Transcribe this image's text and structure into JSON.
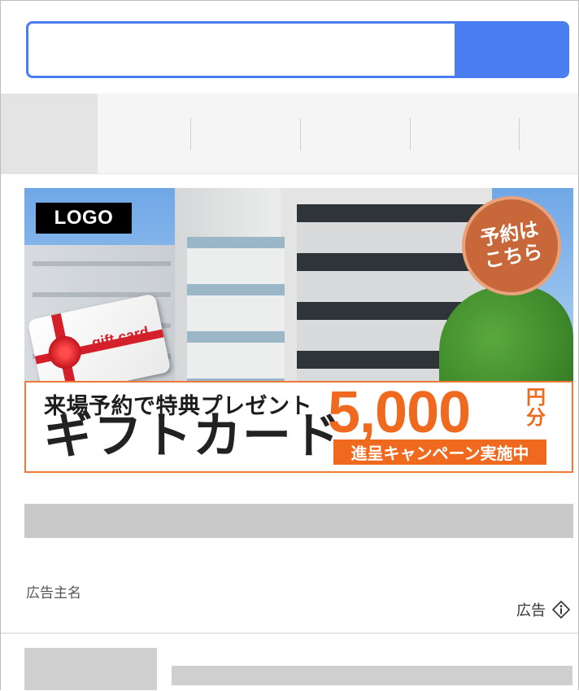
{
  "search": {
    "value": "",
    "placeholder": ""
  },
  "tabs": [
    {
      "label": ""
    },
    {
      "label": ""
    },
    {
      "label": ""
    },
    {
      "label": ""
    },
    {
      "label": ""
    }
  ],
  "ad": {
    "logo_text": "LOGO",
    "reserve_badge": "予約は\nこちら",
    "gift_card_text": "gift card",
    "headline_top": "来場予約で特典プレゼント",
    "headline_main": "ギフトカード",
    "amount": "5,000",
    "amount_unit": "円\n分",
    "campaign": "進呈キャンペーン実施中",
    "advertiser": "広告主名",
    "ad_label": "広告"
  },
  "colors": {
    "accent": "#4a7df0",
    "promo_orange": "#ef6a1e",
    "badge_brown": "#c8683a",
    "placeholder_gray": "#c9c9c9"
  },
  "icons": {
    "ad_info": "info-icon"
  }
}
